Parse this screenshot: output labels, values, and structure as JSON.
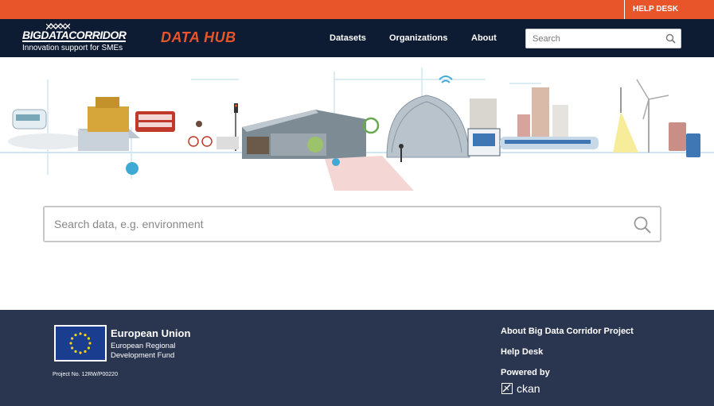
{
  "topbar": {
    "help_desk": "HELP DESK"
  },
  "header": {
    "logo_title": "BIGDATACORRIDOR",
    "logo_subtitle": "Innovation support for SMEs",
    "hub_title": "DATA HUB",
    "nav": [
      "Datasets",
      "Organizations",
      "About"
    ],
    "search_placeholder": "Search"
  },
  "main": {
    "search_placeholder": "Search data, e.g. environment"
  },
  "footer": {
    "eu_title": "European Union",
    "eu_subtitle": "European Regional Development Fund",
    "project_no": "Project No. 12RW/P00220",
    "links": [
      "About Big Data Corridor Project",
      "Help Desk"
    ],
    "powered_by": "Powered by",
    "ckan": "ckan"
  },
  "colors": {
    "accent": "#e8552a",
    "header_bg": "#0d1b33",
    "footer_bg": "#2a3550",
    "eu_blue": "#1a3d8f"
  },
  "icons": [
    "search-icon",
    "eu-flag-icon",
    "ckan-logo-icon"
  ]
}
